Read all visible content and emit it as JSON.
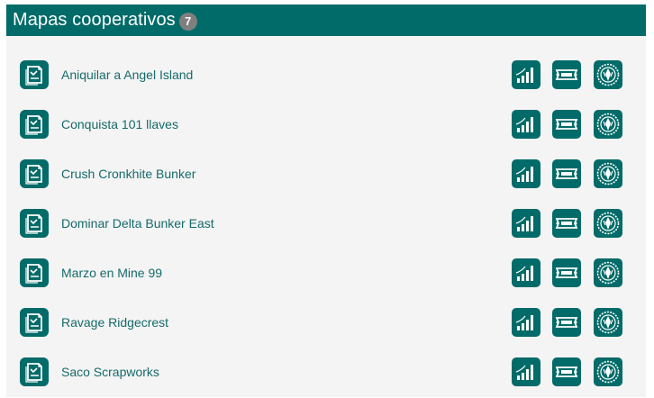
{
  "header": {
    "title": "Mapas cooperativos",
    "count": "7"
  },
  "colors": {
    "brand": "#006b68",
    "badge": "#7f7f7f",
    "link": "#166a6a",
    "panel_bg": "#f4f4f4"
  },
  "maps": [
    {
      "name": "Aniquilar a Angel Island"
    },
    {
      "name": "Conquista 101 llaves"
    },
    {
      "name": "Crush Cronkhite Bunker"
    },
    {
      "name": "Dominar Delta Bunker East"
    },
    {
      "name": "Marzo en Mine 99"
    },
    {
      "name": "Ravage Ridgecrest"
    },
    {
      "name": "Saco Scrapworks"
    }
  ],
  "icons": {
    "map": "map-document-icon",
    "power": "power-level-bars-icon",
    "slab": "banner-slab-icon",
    "emblem": "round-emblem-icon"
  }
}
